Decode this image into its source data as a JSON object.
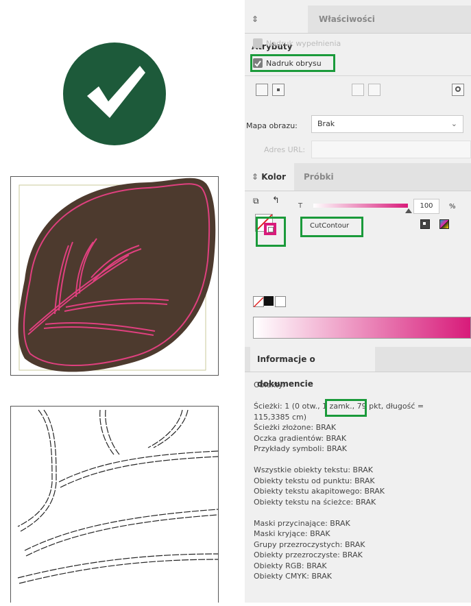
{
  "attributes_panel": {
    "tab_attributes": "Atrybuty",
    "tab_properties": "Właściwości",
    "overprint_fill_label": "Nadruk wypełnienia",
    "overprint_stroke_label": "Nadruk obrysu",
    "image_map_label": "Mapa obrazu:",
    "image_map_value": "Brak",
    "url_label": "Adres URL:"
  },
  "color_panel": {
    "tab_color": "Kolor",
    "tab_swatches": "Próbki",
    "tint_label": "T",
    "tint_value": "100",
    "tint_unit": "%",
    "swatch_name": "CutContour",
    "accent_color": "#d81b7a"
  },
  "document_info": {
    "title": "Informacje o dokumencie",
    "lines": [
      "Obiekty:",
      "",
      "Ścieżki: 1 (0 otw., 1 zamk., 79 pkt, długość =",
      "115,3385 cm)",
      "Ścieżki złożone: BRAK",
      "Oczka gradientów: BRAK",
      "Przykłady symboli: BRAK",
      "",
      "Wszystkie obiekty tekstu: BRAK",
      "Obiekty tekstu od punktu: BRAK",
      "Obiekty tekstu akapitowego: BRAK",
      "Obiekty tekstu na ścieżce: BRAK",
      "",
      "Maski przycinające: BRAK",
      "Maski kryjące: BRAK",
      "Grupy przezroczystych: BRAK",
      "Obiekty przezroczyste: BRAK",
      "Obiekty RGB: BRAK",
      "Obiekty CMYK: BRAK"
    ]
  },
  "colors": {
    "badge_green": "#1d5a3a",
    "leaf_brown": "#4d3a2e",
    "cut_line_pink": "#e0407f",
    "highlight_green": "#1a9a3a"
  }
}
